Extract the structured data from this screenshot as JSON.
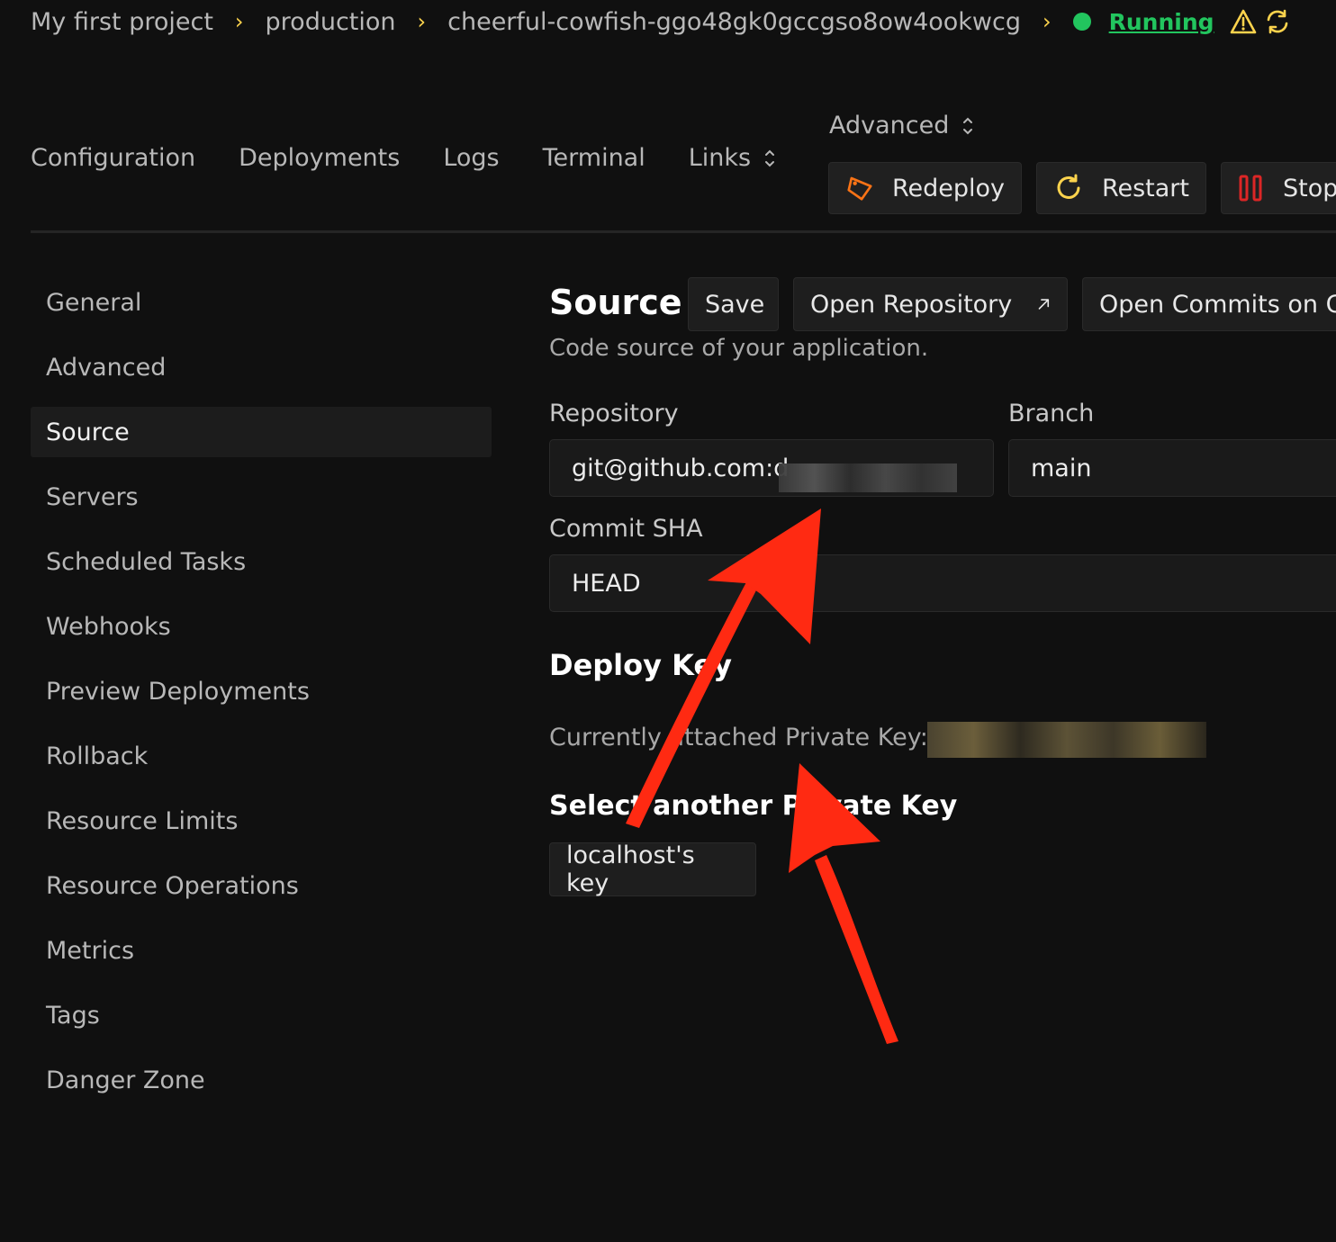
{
  "breadcrumb": {
    "project": "My first project",
    "environment": "production",
    "resource": "cheerful-cowfish-ggo48gk0gccgso8ow4ookwcg",
    "status": "Running"
  },
  "tabs": [
    "Configuration",
    "Deployments",
    "Logs",
    "Terminal",
    "Links"
  ],
  "advanced_menu": "Advanced",
  "actions": {
    "redeploy": "Redeploy",
    "restart": "Restart",
    "stop": "Stop"
  },
  "sidebar": {
    "items": [
      "General",
      "Advanced",
      "Source",
      "Servers",
      "Scheduled Tasks",
      "Webhooks",
      "Preview Deployments",
      "Rollback",
      "Resource Limits",
      "Resource Operations",
      "Metrics",
      "Tags",
      "Danger Zone"
    ],
    "active": "Source"
  },
  "source": {
    "title": "Source",
    "save": "Save",
    "open_repository": "Open Repository",
    "open_commits": "Open Commits on G",
    "subtitle": "Code source of your application.",
    "repository_label": "Repository",
    "repository_value": "git@github.com:d",
    "branch_label": "Branch",
    "branch_value": "main",
    "commit_label": "Commit SHA",
    "commit_value": "HEAD"
  },
  "deploy_key": {
    "title": "Deploy Key",
    "current_label": "Currently attached Private Key:",
    "select_title": "Select another Private Key",
    "key_option": "localhost's key"
  },
  "colors": {
    "background": "#101010",
    "accent_yellow": "#fcd34d",
    "status_green": "#22c55e",
    "stop_red": "#dc2626",
    "redeploy_orange": "#f97316",
    "annotation_red": "#ff2a12"
  }
}
